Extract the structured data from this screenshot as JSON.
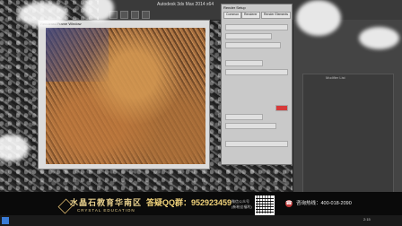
{
  "app": {
    "title": "Autodesk 3ds Max 2014 x64"
  },
  "render_window": {
    "title": "Rendered Frame Window"
  },
  "dialog": {
    "title": "Render Setup",
    "tabs": [
      "Common",
      "Renderer",
      "Render Elements"
    ]
  },
  "command_panel": {
    "label": "Modifier List"
  },
  "banner": {
    "brand_cn": "水晶石教育华南区",
    "brand_en": "CRYSTAL EDUCATION",
    "qq": "答疑QQ群：952923459",
    "wechat_label_1": "微信公众号",
    "wechat_label_2": "(新粉丝福利)",
    "phone": "咨询热线：400-018-2090",
    "phone_icon": "phone-icon"
  },
  "taskbar": {
    "time": "2:15"
  },
  "colors": {
    "banner_gold": "#e7cf8c",
    "dialog_bg": "#c9c9c9",
    "accent_red": "#d63a3a"
  }
}
